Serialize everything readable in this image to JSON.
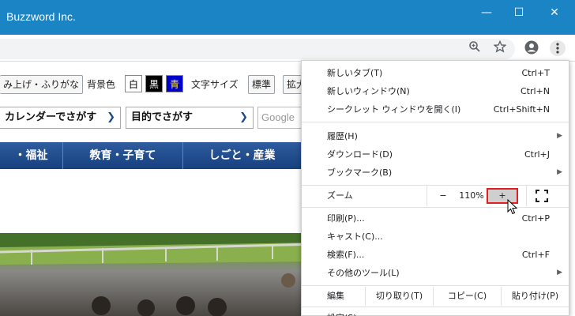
{
  "window": {
    "title": "Buzzword Inc.",
    "minimize_glyph": "—",
    "maximize_glyph": "☐",
    "close_glyph": "✕"
  },
  "toolbar": {
    "icons": [
      "zoom-icon",
      "star-icon",
      "profile-icon",
      "menu-icon"
    ]
  },
  "page": {
    "a11y_read": "み上げ・ふりがな",
    "bg_label": "背景色",
    "bg_white": "白",
    "bg_black": "黒",
    "bg_blue": "青",
    "font_size_label": "文字サイズ",
    "font_standard": "標準",
    "font_large": "拡大",
    "calendar_search": "カレンダーでさがす",
    "purpose_search": "目的でさがす",
    "google_placeholder": "Google",
    "nav": [
      "・福祉",
      "教育・子育て",
      "しごと・産業"
    ]
  },
  "menu": {
    "new_tab": {
      "label": "新しいタブ(T)",
      "shortcut": "Ctrl+T"
    },
    "new_window": {
      "label": "新しいウィンドウ(N)",
      "shortcut": "Ctrl+N"
    },
    "incognito": {
      "label": "シークレット ウィンドウを開く(I)",
      "shortcut": "Ctrl+Shift+N"
    },
    "history": {
      "label": "履歴(H)"
    },
    "downloads": {
      "label": "ダウンロード(D)",
      "shortcut": "Ctrl+J"
    },
    "bookmarks": {
      "label": "ブックマーク(B)"
    },
    "zoom": {
      "label": "ズーム",
      "minus": "−",
      "value": "110%",
      "plus": "+"
    },
    "print": {
      "label": "印刷(P)...",
      "shortcut": "Ctrl+P"
    },
    "cast": {
      "label": "キャスト(C)..."
    },
    "find": {
      "label": "検索(F)...",
      "shortcut": "Ctrl+F"
    },
    "more_tools": {
      "label": "その他のツール(L)"
    },
    "edit": {
      "label": "編集",
      "cut": "切り取り(T)",
      "copy": "コピー(C)",
      "paste": "貼り付け(P)"
    },
    "settings": {
      "label": "設定(S)"
    }
  },
  "colors": {
    "titlebar": "#1a84c5",
    "nav_bar": "#17407f",
    "zoom_highlight": "#e02020"
  }
}
